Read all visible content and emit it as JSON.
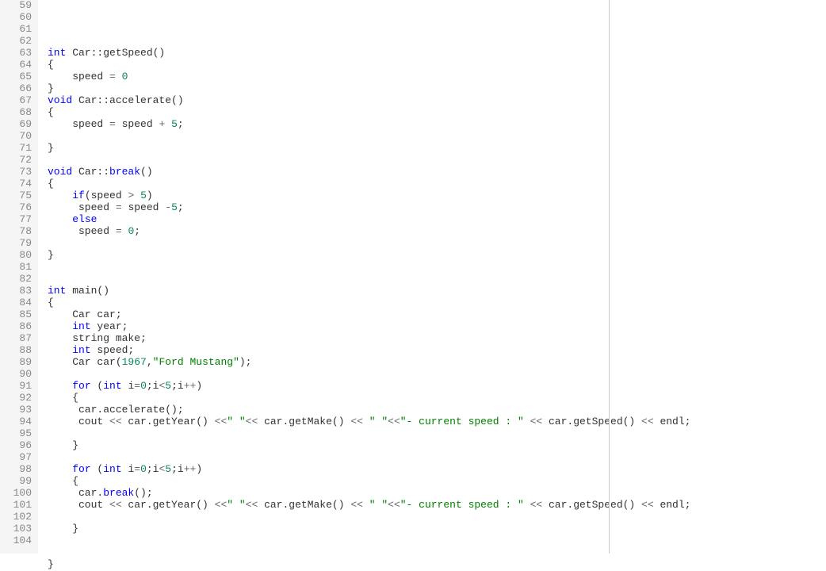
{
  "editor": {
    "startLine": 59,
    "endLine": 104,
    "rulerColumn": 88,
    "lines": [
      {
        "n": 59,
        "tokens": []
      },
      {
        "n": 60,
        "tokens": []
      },
      {
        "n": 61,
        "tokens": [
          {
            "t": "int",
            "c": "type"
          },
          {
            "t": " Car::getSpeed()",
            "c": ""
          }
        ]
      },
      {
        "n": 62,
        "tokens": [
          {
            "t": "{",
            "c": ""
          }
        ]
      },
      {
        "n": 63,
        "tokens": [
          {
            "t": "    speed ",
            "c": ""
          },
          {
            "t": "=",
            "c": "op"
          },
          {
            "t": " ",
            "c": ""
          },
          {
            "t": "0",
            "c": "num"
          }
        ]
      },
      {
        "n": 64,
        "tokens": [
          {
            "t": "}",
            "c": ""
          }
        ]
      },
      {
        "n": 65,
        "tokens": [
          {
            "t": "void",
            "c": "type"
          },
          {
            "t": " Car::accelerate()",
            "c": ""
          }
        ]
      },
      {
        "n": 66,
        "tokens": [
          {
            "t": "{",
            "c": ""
          }
        ]
      },
      {
        "n": 67,
        "tokens": [
          {
            "t": "    speed ",
            "c": ""
          },
          {
            "t": "=",
            "c": "op"
          },
          {
            "t": " speed ",
            "c": ""
          },
          {
            "t": "+",
            "c": "op"
          },
          {
            "t": " ",
            "c": ""
          },
          {
            "t": "5",
            "c": "num"
          },
          {
            "t": ";",
            "c": ""
          }
        ]
      },
      {
        "n": 68,
        "tokens": []
      },
      {
        "n": 69,
        "tokens": [
          {
            "t": "}",
            "c": ""
          }
        ]
      },
      {
        "n": 70,
        "tokens": []
      },
      {
        "n": 71,
        "tokens": [
          {
            "t": "void",
            "c": "type"
          },
          {
            "t": " Car::",
            "c": ""
          },
          {
            "t": "break",
            "c": "kw"
          },
          {
            "t": "()",
            "c": ""
          }
        ]
      },
      {
        "n": 72,
        "tokens": [
          {
            "t": "{",
            "c": ""
          }
        ]
      },
      {
        "n": 73,
        "tokens": [
          {
            "t": "    ",
            "c": ""
          },
          {
            "t": "if",
            "c": "kw"
          },
          {
            "t": "(speed ",
            "c": ""
          },
          {
            "t": ">",
            "c": "op"
          },
          {
            "t": " ",
            "c": ""
          },
          {
            "t": "5",
            "c": "num"
          },
          {
            "t": ")",
            "c": ""
          }
        ]
      },
      {
        "n": 74,
        "tokens": [
          {
            "t": "     speed ",
            "c": ""
          },
          {
            "t": "=",
            "c": "op"
          },
          {
            "t": " speed ",
            "c": ""
          },
          {
            "t": "-",
            "c": "op"
          },
          {
            "t": "5",
            "c": "num"
          },
          {
            "t": ";",
            "c": ""
          }
        ]
      },
      {
        "n": 75,
        "tokens": [
          {
            "t": "    ",
            "c": ""
          },
          {
            "t": "else",
            "c": "kw"
          }
        ]
      },
      {
        "n": 76,
        "tokens": [
          {
            "t": "     speed ",
            "c": ""
          },
          {
            "t": "=",
            "c": "op"
          },
          {
            "t": " ",
            "c": ""
          },
          {
            "t": "0",
            "c": "num"
          },
          {
            "t": ";",
            "c": ""
          }
        ]
      },
      {
        "n": 77,
        "tokens": []
      },
      {
        "n": 78,
        "tokens": [
          {
            "t": "}",
            "c": ""
          }
        ]
      },
      {
        "n": 79,
        "tokens": []
      },
      {
        "n": 80,
        "tokens": []
      },
      {
        "n": 81,
        "tokens": [
          {
            "t": "int",
            "c": "type"
          },
          {
            "t": " main()",
            "c": ""
          }
        ]
      },
      {
        "n": 82,
        "tokens": [
          {
            "t": "{",
            "c": ""
          }
        ]
      },
      {
        "n": 83,
        "tokens": [
          {
            "t": "    Car car;",
            "c": ""
          }
        ]
      },
      {
        "n": 84,
        "tokens": [
          {
            "t": "    ",
            "c": ""
          },
          {
            "t": "int",
            "c": "type"
          },
          {
            "t": " year;",
            "c": ""
          }
        ]
      },
      {
        "n": 85,
        "tokens": [
          {
            "t": "    string make;",
            "c": ""
          }
        ]
      },
      {
        "n": 86,
        "tokens": [
          {
            "t": "    ",
            "c": ""
          },
          {
            "t": "int",
            "c": "type"
          },
          {
            "t": " speed;",
            "c": ""
          }
        ]
      },
      {
        "n": 87,
        "tokens": [
          {
            "t": "    Car car(",
            "c": ""
          },
          {
            "t": "1967",
            "c": "num"
          },
          {
            "t": ",",
            "c": ""
          },
          {
            "t": "\"Ford Mustang\"",
            "c": "str"
          },
          {
            "t": ");",
            "c": ""
          }
        ]
      },
      {
        "n": 88,
        "tokens": []
      },
      {
        "n": 89,
        "tokens": [
          {
            "t": "    ",
            "c": ""
          },
          {
            "t": "for",
            "c": "kw"
          },
          {
            "t": " (",
            "c": ""
          },
          {
            "t": "int",
            "c": "type"
          },
          {
            "t": " i",
            "c": ""
          },
          {
            "t": "=",
            "c": "op"
          },
          {
            "t": "0",
            "c": "num"
          },
          {
            "t": ";i",
            "c": ""
          },
          {
            "t": "<",
            "c": "op"
          },
          {
            "t": "5",
            "c": "num"
          },
          {
            "t": ";i",
            "c": ""
          },
          {
            "t": "++",
            "c": "op"
          },
          {
            "t": ")",
            "c": ""
          }
        ]
      },
      {
        "n": 90,
        "tokens": [
          {
            "t": "    {",
            "c": ""
          }
        ]
      },
      {
        "n": 91,
        "tokens": [
          {
            "t": "     car.accelerate();",
            "c": ""
          }
        ]
      },
      {
        "n": 92,
        "tokens": [
          {
            "t": "     cout ",
            "c": ""
          },
          {
            "t": "<<",
            "c": "op"
          },
          {
            "t": " car.getYear() ",
            "c": ""
          },
          {
            "t": "<<",
            "c": "op"
          },
          {
            "t": "\" \"",
            "c": "str"
          },
          {
            "t": "<<",
            "c": "op"
          },
          {
            "t": " car.getMake() ",
            "c": ""
          },
          {
            "t": "<<",
            "c": "op"
          },
          {
            "t": " ",
            "c": ""
          },
          {
            "t": "\" \"",
            "c": "str"
          },
          {
            "t": "<<",
            "c": "op"
          },
          {
            "t": "\"- current speed : \"",
            "c": "str"
          },
          {
            "t": " ",
            "c": ""
          },
          {
            "t": "<<",
            "c": "op"
          },
          {
            "t": " car.getSpeed() ",
            "c": ""
          },
          {
            "t": "<<",
            "c": "op"
          },
          {
            "t": " endl;",
            "c": ""
          }
        ]
      },
      {
        "n": 93,
        "tokens": []
      },
      {
        "n": 94,
        "tokens": [
          {
            "t": "    }",
            "c": ""
          }
        ]
      },
      {
        "n": 95,
        "tokens": []
      },
      {
        "n": 96,
        "tokens": [
          {
            "t": "    ",
            "c": ""
          },
          {
            "t": "for",
            "c": "kw"
          },
          {
            "t": " (",
            "c": ""
          },
          {
            "t": "int",
            "c": "type"
          },
          {
            "t": " i",
            "c": ""
          },
          {
            "t": "=",
            "c": "op"
          },
          {
            "t": "0",
            "c": "num"
          },
          {
            "t": ";i",
            "c": ""
          },
          {
            "t": "<",
            "c": "op"
          },
          {
            "t": "5",
            "c": "num"
          },
          {
            "t": ";i",
            "c": ""
          },
          {
            "t": "++",
            "c": "op"
          },
          {
            "t": ")",
            "c": ""
          }
        ]
      },
      {
        "n": 97,
        "tokens": [
          {
            "t": "    {",
            "c": ""
          }
        ]
      },
      {
        "n": 98,
        "tokens": [
          {
            "t": "     car.",
            "c": ""
          },
          {
            "t": "break",
            "c": "kw"
          },
          {
            "t": "();",
            "c": ""
          }
        ]
      },
      {
        "n": 99,
        "tokens": [
          {
            "t": "     cout ",
            "c": ""
          },
          {
            "t": "<<",
            "c": "op"
          },
          {
            "t": " car.getYear() ",
            "c": ""
          },
          {
            "t": "<<",
            "c": "op"
          },
          {
            "t": "\" \"",
            "c": "str"
          },
          {
            "t": "<<",
            "c": "op"
          },
          {
            "t": " car.getMake() ",
            "c": ""
          },
          {
            "t": "<<",
            "c": "op"
          },
          {
            "t": " ",
            "c": ""
          },
          {
            "t": "\" \"",
            "c": "str"
          },
          {
            "t": "<<",
            "c": "op"
          },
          {
            "t": "\"- current speed : \"",
            "c": "str"
          },
          {
            "t": " ",
            "c": ""
          },
          {
            "t": "<<",
            "c": "op"
          },
          {
            "t": " car.getSpeed() ",
            "c": ""
          },
          {
            "t": "<<",
            "c": "op"
          },
          {
            "t": " endl;",
            "c": ""
          }
        ]
      },
      {
        "n": 100,
        "tokens": []
      },
      {
        "n": 101,
        "tokens": [
          {
            "t": "    }",
            "c": ""
          }
        ]
      },
      {
        "n": 102,
        "tokens": []
      },
      {
        "n": 103,
        "tokens": []
      },
      {
        "n": 104,
        "tokens": [
          {
            "t": "}",
            "c": ""
          }
        ]
      }
    ]
  }
}
